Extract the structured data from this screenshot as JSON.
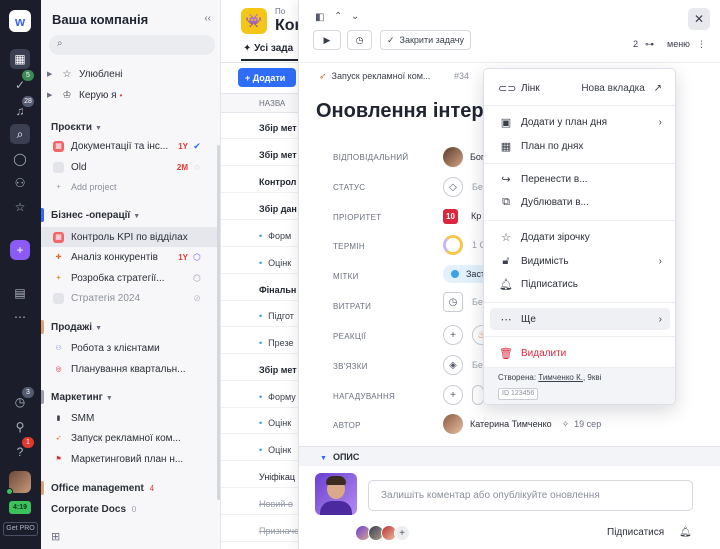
{
  "rail": {
    "logo": "w",
    "badges": {
      "tasks": "5",
      "inbox": "28",
      "timer": "3",
      "help": "1"
    },
    "time": "4:19",
    "get_pro": "Get PRO"
  },
  "sidebar": {
    "title": "Ваша компанія",
    "favorites": "Улюблені",
    "managing": "Керую я",
    "projects_header": "Проєкти",
    "projects": [
      {
        "name": "Документації та інс...",
        "tag": "1Y"
      },
      {
        "name": "Old",
        "tag": "2M"
      }
    ],
    "add_project": "Add project",
    "business_header": "Бізнес -операції",
    "business": [
      {
        "name": "Контроль KPI по відділах"
      },
      {
        "name": "Аналіз конкурентів",
        "tag": "1Y"
      },
      {
        "name": "Розробка стратегії..."
      },
      {
        "name": "Стратегія 2024"
      }
    ],
    "sales_header": "Продажі",
    "sales": [
      {
        "name": "Робота з клієнтами"
      },
      {
        "name": "Планування квартальн..."
      }
    ],
    "marketing_header": "Маркетинг",
    "marketing": [
      {
        "name": "SMM"
      },
      {
        "name": "Запуск рекламної ком..."
      },
      {
        "name": "Маркетинговий план н..."
      }
    ],
    "office_header": "Office management",
    "office_count": "4",
    "docs_header": "Corporate Docs",
    "docs_count": "0"
  },
  "main": {
    "header_small": "По",
    "header_title": "Конт",
    "tab_label": "Усі зада",
    "add_button": "+ Додати",
    "column_name": "НАЗВА",
    "rows": [
      "Збір мет",
      "Збір мет",
      "Контрол",
      "Збір дан",
      "Форм",
      "Оцінк",
      "Фінальн",
      "Підгот",
      "Презе",
      "Збір мет",
      "Форму",
      "Оцінк",
      "Оцінк",
      "Уніфікац",
      "Новий о",
      "Призначе"
    ]
  },
  "panel": {
    "complete_label": "Закрити задачу",
    "subtask_count": "2",
    "menu_label": "меню",
    "crumb": "Запуск рекламної ком...",
    "crumb_id": "#34",
    "title": "Оновлення інтер",
    "fields": {
      "assignee_label": "ВІДПОВІДАЛЬНИЙ",
      "assignee_value": "Бог",
      "status_label": "СТАТУС",
      "status_value": "Бе",
      "priority_label": "ПРІОРИТЕТ",
      "priority_value": "10",
      "priority_text": "Кр",
      "due_label": "ТЕРМІН",
      "due_value": "1 С",
      "tags_label": "МІТКИ",
      "tags_value": "Заст",
      "expenses_label": "ВИТРАТИ",
      "expenses_value": "Бе",
      "reactions_label": "РЕАКЦІЇ",
      "links_label": "ЗВ'ЯЗКИ",
      "links_value": "Бе",
      "reminders_label": "НАГАДУВАННЯ",
      "author_label": "АВТОР",
      "author_value": "Катерина Тимченко",
      "author_date": "19 сер"
    },
    "description_label": "ОПИС",
    "comment_placeholder": "Залишіть коментар або опублікуйте оновлення",
    "subscribe_label": "Підписатися"
  },
  "menu": {
    "items": [
      {
        "label": "Лінк",
        "right": "Нова вкладка"
      },
      {
        "label": "Додати у план дня"
      },
      {
        "label": "План по днях"
      },
      {
        "label": "Перенести в..."
      },
      {
        "label": "Дублювати в..."
      },
      {
        "label": "Додати зірочку"
      },
      {
        "label": "Видимість"
      },
      {
        "label": "Підписатись"
      },
      {
        "label": "Ще"
      },
      {
        "label": "Видалити"
      }
    ],
    "created_prefix": "Створена:",
    "created_by": "Тимченко К.",
    "created_time": "9кві",
    "id_label": "ID 123456"
  },
  "colors": {
    "accent": "#2f6df6",
    "danger": "#d8283e",
    "rail_bg": "#1b1e2a",
    "priority": "#d8283e"
  }
}
